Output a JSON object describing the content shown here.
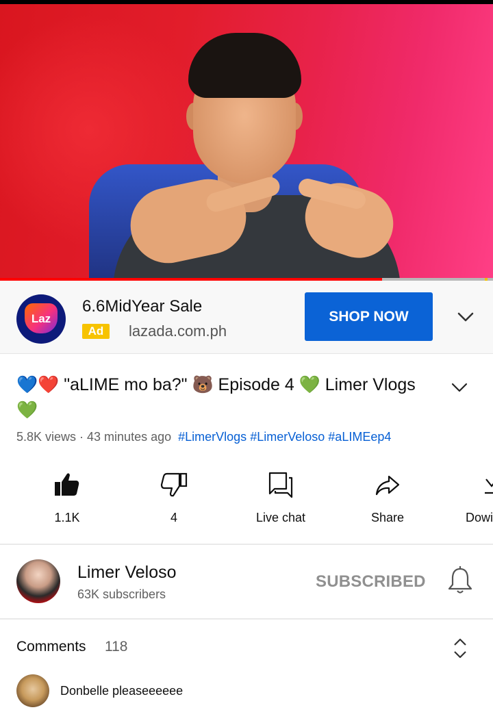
{
  "progress": {
    "watched_fraction": 0.775
  },
  "ad": {
    "logo_text": "Laz",
    "title": "6.6MidYear Sale",
    "badge": "Ad",
    "domain": "lazada.com.ph",
    "cta": "SHOP NOW"
  },
  "video": {
    "title": "💙❤️ \"aLIME mo ba?\" 🐻 Episode 4 💚 Limer Vlogs 💚",
    "views_time": "5.8K views · 43 minutes ago",
    "hashtags": [
      "#LimerVlogs",
      "#LimerVeloso",
      "#aLIMEep4"
    ]
  },
  "actions": {
    "like": "1.1K",
    "dislike": "4",
    "live_chat": "Live chat",
    "share": "Share",
    "download": "Dowi"
  },
  "channel": {
    "name": "Limer Veloso",
    "subscribers": "63K subscribers",
    "subscribe_state": "SUBSCRIBED"
  },
  "comments": {
    "label": "Comments",
    "count": "118",
    "top_comment": "Donbelle pleaseeeeee"
  },
  "colors": {
    "progress_red": "#ff0000",
    "cta_blue": "#0b63d6",
    "ad_badge_yellow": "#f7c300",
    "hashtag_blue": "#065fd4"
  }
}
